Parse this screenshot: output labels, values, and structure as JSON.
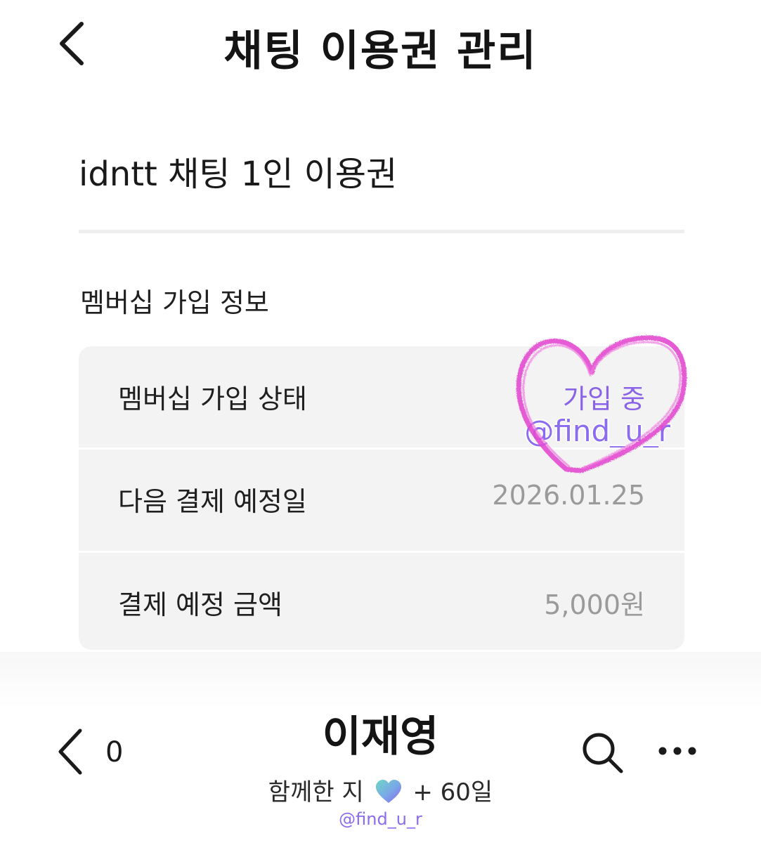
{
  "header": {
    "title": "채팅 이용권 관리",
    "back_icon": "chevron-left-icon"
  },
  "product": {
    "name": "idntt 채팅 1인 이용권"
  },
  "membership": {
    "section_title": "멤버십 가입 정보",
    "rows": [
      {
        "label": "멤버십 가입 상태",
        "value": "가입 중"
      },
      {
        "label": "다음 결제 예정일",
        "value": "2026.01.25"
      },
      {
        "label": "결제 예정 금액",
        "value": "5,000원"
      }
    ],
    "watermark": "@find_u_r",
    "status_color": "#8a63e8",
    "doodle_color": "#e24bd0"
  },
  "chat_header": {
    "back_icon": "chevron-left-icon",
    "unread_count": "0",
    "name": "이재영",
    "together_prefix": "함께한 지",
    "heart_icon": "gradient-heart-icon",
    "together_suffix": "+ 60일",
    "search_icon": "search-icon",
    "more_icon": "more-horizontal-icon",
    "watermark": "@find_u_r"
  }
}
